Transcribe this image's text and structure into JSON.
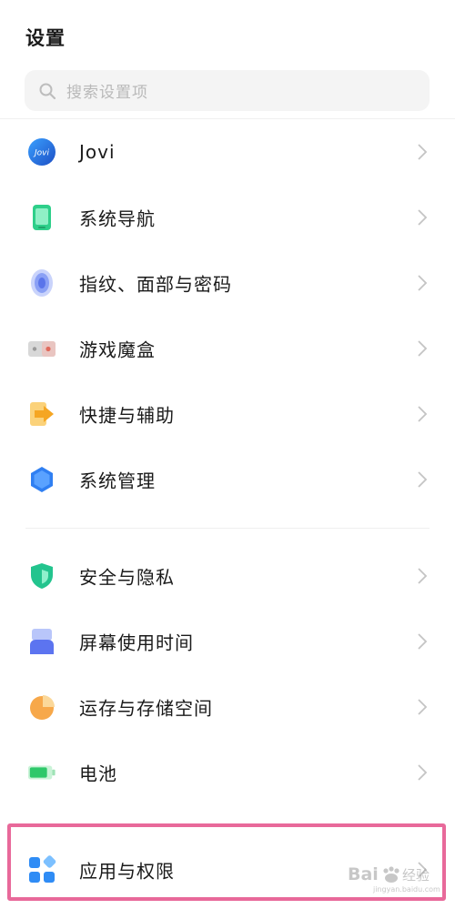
{
  "header": {
    "title": "设置"
  },
  "search": {
    "placeholder": "搜索设置项"
  },
  "items": [
    {
      "label": "Jovi",
      "icon": "jovi-icon"
    },
    {
      "label": "系统导航",
      "icon": "phone-navigation-icon"
    },
    {
      "label": "指纹、面部与密码",
      "icon": "fingerprint-icon"
    },
    {
      "label": "游戏魔盒",
      "icon": "game-box-icon"
    },
    {
      "label": "快捷与辅助",
      "icon": "shortcut-arrow-icon"
    },
    {
      "label": "系统管理",
      "icon": "system-hexagon-icon"
    },
    {
      "label": "安全与隐私",
      "icon": "security-shield-icon"
    },
    {
      "label": "屏幕使用时间",
      "icon": "screen-time-icon"
    },
    {
      "label": "运存与存储空间",
      "icon": "storage-pie-icon"
    },
    {
      "label": "电池",
      "icon": "battery-icon"
    },
    {
      "label": "应用与权限",
      "icon": "apps-grid-icon"
    }
  ],
  "watermark": {
    "brand": "Baidu经验",
    "url": "jingyan.baidu.com"
  },
  "colors": {
    "highlight_border": "#e8699a",
    "jovi_blue": "#1f6fd6",
    "nav_green": "#2ecf8a",
    "fingerprint_blue": "#6f8bf2",
    "shortcut_orange": "#f5a623",
    "system_blue": "#2f7ff2",
    "security_green": "#23c48e",
    "storage_orange": "#f7a84a",
    "battery_green": "#2ec86a",
    "apps_blue": "#2f8cf5"
  }
}
